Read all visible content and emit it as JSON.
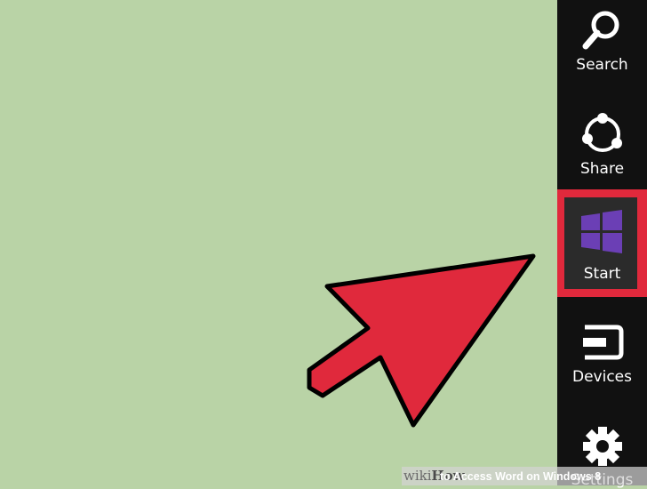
{
  "desktop": {
    "background_color": "#b9d3a6"
  },
  "charms": {
    "background_color": "#111111",
    "items": [
      {
        "label": "Search",
        "icon": "search-icon"
      },
      {
        "label": "Share",
        "icon": "share-icon"
      },
      {
        "label": "Start",
        "icon": "windows-logo-icon",
        "highlighted": true,
        "highlight_color": "#e0293c",
        "icon_color": "#6b3fb5"
      },
      {
        "label": "Devices",
        "icon": "devices-icon"
      },
      {
        "label": "Settings",
        "icon": "gear-icon"
      }
    ]
  },
  "annotation": {
    "arrow_color": "#e0293c",
    "arrow_outline": "#000000",
    "points_to": "Start"
  },
  "watermark": {
    "logo_prefix": "wiki",
    "logo_suffix": "How",
    "title": "to Access Word on Windows 8"
  }
}
